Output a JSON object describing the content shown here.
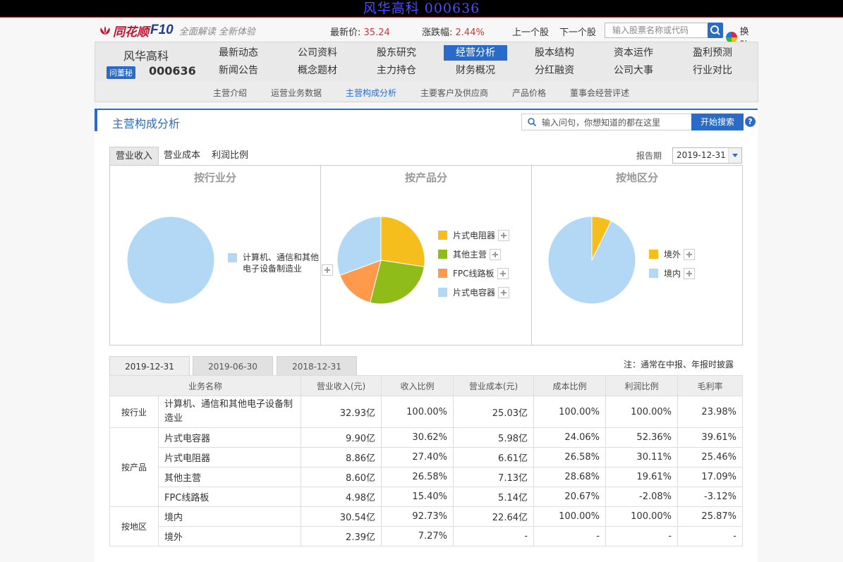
{
  "window_title": "风华高科 000636",
  "brand": {
    "name": "同花顺",
    "f10": "F10",
    "slogan": "全面解读 全新体验"
  },
  "quote": {
    "price_label": "最新价:",
    "price": "35.24",
    "change_label": "涨跌幅:",
    "change": "2.44%"
  },
  "nav_prev": "上一个股",
  "nav_next": "下一个股",
  "stock_search_placeholder": "输入股票名称或代码",
  "skin_label": "换肤",
  "stock": {
    "name": "风华高科",
    "code": "000636",
    "dongmi": "问董秘"
  },
  "nav_row1": [
    "最新动态",
    "公司资料",
    "股东研究",
    "经营分析",
    "股本结构",
    "资本运作",
    "盈利预测"
  ],
  "nav_row2": [
    "新闻公告",
    "概念题材",
    "主力持仓",
    "财务概况",
    "分红融资",
    "公司大事",
    "行业对比"
  ],
  "subnav": [
    "主营介绍",
    "运营业务数据",
    "主营构成分析",
    "主要客户及供应商",
    "产品价格",
    "董事会经营评述"
  ],
  "panel": {
    "title": "主营构成分析",
    "ask_placeholder": "输入问句，你想知道的都在这里",
    "ask_button": "开始搜索",
    "help": "?"
  },
  "tabs": [
    "营业收入",
    "营业成本",
    "利润比例"
  ],
  "period": {
    "label": "报告期",
    "value": "2019-12-31"
  },
  "chart_data": [
    {
      "type": "pie",
      "title": "按行业分",
      "labels": [
        "计算机、通信和其他电子设备制造业"
      ],
      "values": [
        100.0
      ],
      "colors": [
        "#b3d8f6"
      ]
    },
    {
      "type": "pie",
      "title": "按产品分",
      "labels": [
        "片式电阻器",
        "其他主营",
        "FPC线路板",
        "片式电容器"
      ],
      "values": [
        27.4,
        26.58,
        15.4,
        30.62
      ],
      "colors": [
        "#f5be1c",
        "#8fbc19",
        "#ff9a4d",
        "#b3d8f6"
      ]
    },
    {
      "type": "pie",
      "title": "按地区分",
      "labels": [
        "境外",
        "境内"
      ],
      "values": [
        7.27,
        92.73
      ],
      "colors": [
        "#f5be1c",
        "#b3d8f6"
      ]
    }
  ],
  "date_tabs": [
    "2019-12-31",
    "2019-06-30",
    "2018-12-31"
  ],
  "note": "注：通常在中报、年报时披露",
  "table": {
    "headers": [
      "业务名称",
      "营业收入(元)",
      "收入比例",
      "营业成本(元)",
      "成本比例",
      "利润比例",
      "毛利率"
    ],
    "groups": [
      {
        "category": "按行业",
        "rows": [
          [
            "计算机、通信和其他电子设备制造业",
            "32.93亿",
            "100.00%",
            "25.03亿",
            "100.00%",
            "100.00%",
            "23.98%"
          ]
        ]
      },
      {
        "category": "按产品",
        "rows": [
          [
            "片式电容器",
            "9.90亿",
            "30.62%",
            "5.98亿",
            "24.06%",
            "52.36%",
            "39.61%"
          ],
          [
            "片式电阻器",
            "8.86亿",
            "27.40%",
            "6.61亿",
            "26.58%",
            "30.11%",
            "25.46%"
          ],
          [
            "其他主营",
            "8.60亿",
            "26.58%",
            "7.13亿",
            "28.68%",
            "19.61%",
            "17.09%"
          ],
          [
            "FPC线路板",
            "4.98亿",
            "15.40%",
            "5.14亿",
            "20.67%",
            "-2.08%",
            "-3.12%"
          ]
        ]
      },
      {
        "category": "按地区",
        "rows": [
          [
            "境内",
            "30.54亿",
            "92.73%",
            "22.64亿",
            "100.00%",
            "100.00%",
            "25.87%"
          ],
          [
            "境外",
            "2.39亿",
            "7.27%",
            "-",
            "-",
            "-",
            "-"
          ]
        ]
      }
    ]
  }
}
